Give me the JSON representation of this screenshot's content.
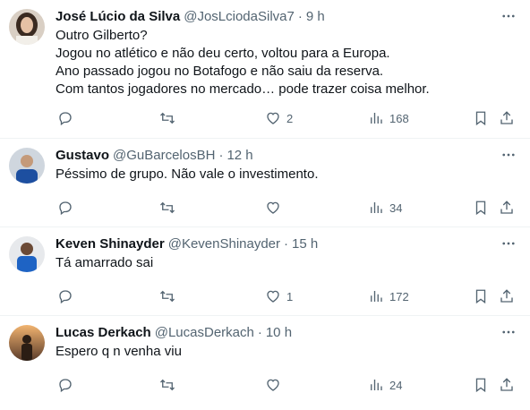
{
  "tweets": [
    {
      "name": "José Lúcio da Silva",
      "handle": "@JosLciodaSilva7",
      "sep": "·",
      "time": "9 h",
      "lines": [
        "Outro Gilberto?",
        "Jogou no atlético e não deu certo, voltou para a Europa.",
        "Ano passado jogou no Botafogo e não saiu da reserva.",
        "Com tantos jogadores no mercado… pode trazer coisa melhor."
      ],
      "replies": "",
      "retweets": "",
      "likes": "2",
      "views": "168"
    },
    {
      "name": "Gustavo",
      "handle": "@GuBarcelosBH",
      "sep": "·",
      "time": "12 h",
      "lines": [
        "Péssimo de grupo. Não vale o investimento."
      ],
      "replies": "",
      "retweets": "",
      "likes": "",
      "views": "34"
    },
    {
      "name": "Keven Shinayder",
      "handle": "@KevenShinayder",
      "sep": "·",
      "time": "15 h",
      "lines": [
        "Tá amarrado sai"
      ],
      "replies": "",
      "retweets": "",
      "likes": "1",
      "views": "172"
    },
    {
      "name": "Lucas Derkach",
      "handle": "@LucasDerkach",
      "sep": "·",
      "time": "10 h",
      "lines": [
        "Espero q n venha viu"
      ],
      "replies": "",
      "retweets": "",
      "likes": "",
      "views": "24"
    }
  ]
}
